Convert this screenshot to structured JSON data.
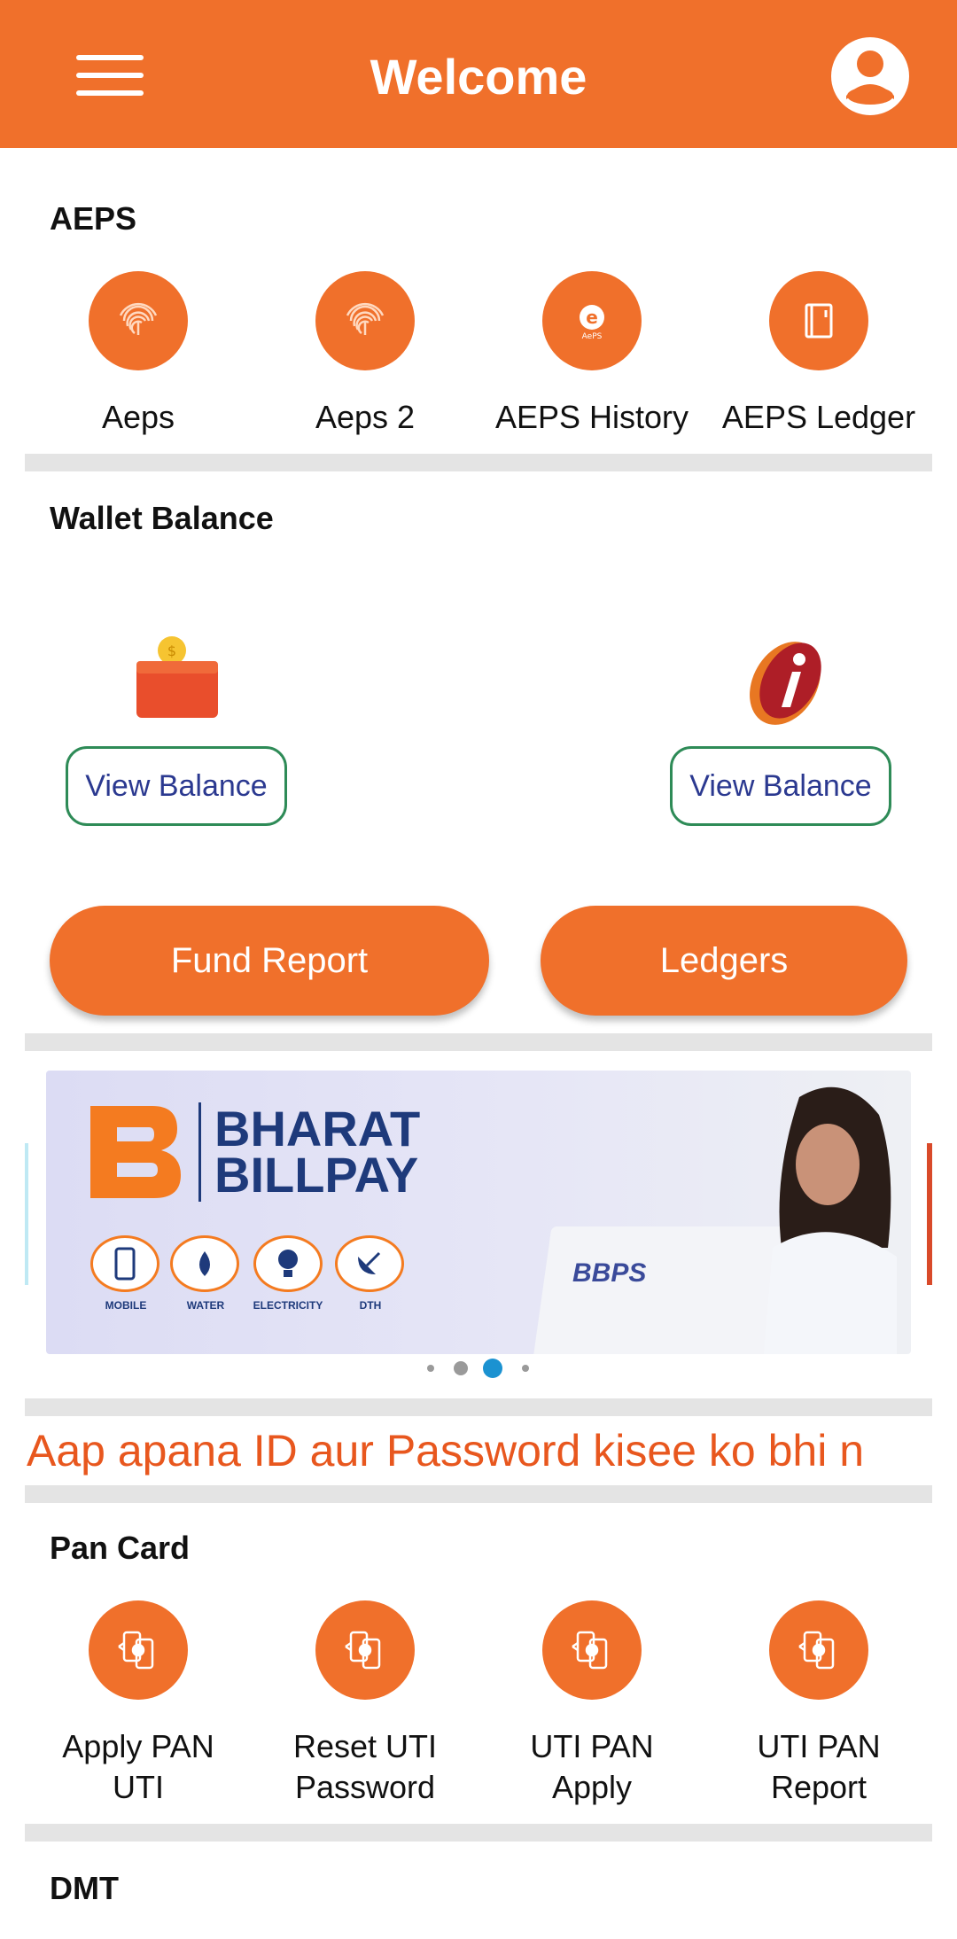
{
  "header": {
    "title": "Welcome"
  },
  "aeps": {
    "title": "AEPS",
    "items": [
      {
        "label": "Aeps",
        "icon": "fingerprint-icon"
      },
      {
        "label": "Aeps 2",
        "icon": "fingerprint-icon"
      },
      {
        "label": "AEPS History",
        "icon": "aeps-logo-icon"
      },
      {
        "label": "AEPS Ledger",
        "icon": "ledger-book-icon"
      }
    ]
  },
  "wallet": {
    "title": "Wallet Balance",
    "left_button": "View Balance",
    "right_button": "View Balance",
    "fund_report": "Fund Report",
    "ledgers": "Ledgers"
  },
  "banner": {
    "brand_line1": "BHARAT",
    "brand_line2": "BILLPAY",
    "services": [
      "MOBILE",
      "WATER",
      "ELECTRICITY",
      "DTH"
    ],
    "laptop_text": "BBPS",
    "active_dot": 2,
    "dot_count": 4
  },
  "notice": {
    "text": "Aap apana ID aur Password kisee ko bhi n"
  },
  "pan": {
    "title": "Pan Card",
    "items": [
      {
        "line1": "Apply PAN",
        "line2": "UTI"
      },
      {
        "line1": "Reset UTI",
        "line2": "Password"
      },
      {
        "line1": "UTI PAN",
        "line2": "Apply"
      },
      {
        "line1": "UTI PAN",
        "line2": "Report"
      }
    ]
  },
  "dmt": {
    "title": "DMT"
  },
  "colors": {
    "accent": "#F0702B",
    "divider": "#E4E4E4",
    "button_border": "#2E8B57",
    "button_text": "#2B3990"
  }
}
